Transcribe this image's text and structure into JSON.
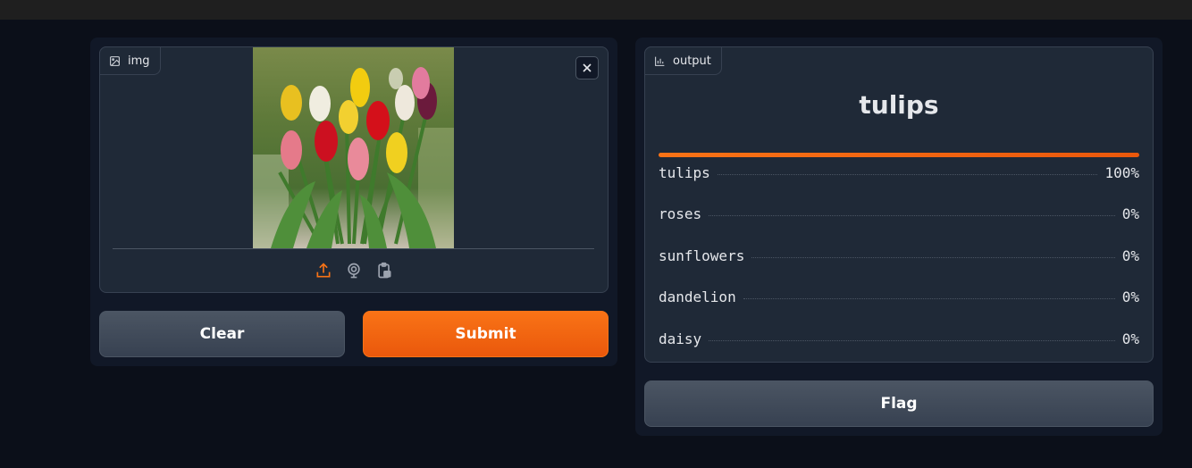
{
  "image_input": {
    "label": "img",
    "image_description": "Bouquet of multicolored tulips (yellow, white, red, pink, purple)"
  },
  "buttons": {
    "clear": "Clear",
    "submit": "Submit",
    "flag": "Flag"
  },
  "output": {
    "label": "output",
    "predicted": "tulips",
    "confidences": [
      {
        "label": "tulips",
        "percent": "100%",
        "value": 1.0
      },
      {
        "label": "roses",
        "percent": "0%",
        "value": 0.0
      },
      {
        "label": "sunflowers",
        "percent": "0%",
        "value": 0.0
      },
      {
        "label": "dandelion",
        "percent": "0%",
        "value": 0.0
      },
      {
        "label": "daisy",
        "percent": "0%",
        "value": 0.0
      }
    ]
  },
  "colors": {
    "accent": "#f97316",
    "background": "#0b0f19",
    "panel": "#111827",
    "block": "#1f2937"
  }
}
